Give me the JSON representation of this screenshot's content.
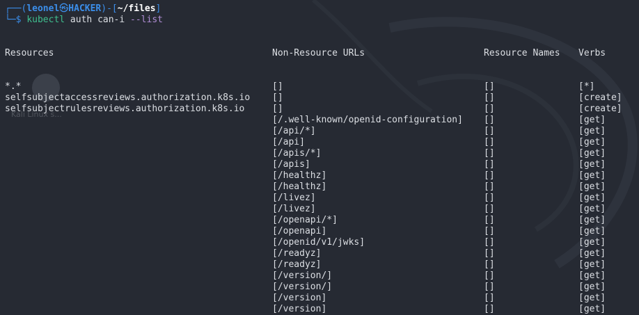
{
  "prompt": {
    "corner_top": "┌──(",
    "user": "leonel",
    "skull": "㉿",
    "host": "HACKER",
    "sep": ")-[",
    "path": "~/files",
    "close": "]",
    "corner_bottom": "└─",
    "dollar": "$",
    "command": "kubectl",
    "args": " auth can-i ",
    "flag": "--list"
  },
  "desktop": {
    "ghost_label": "Kali Linux s..."
  },
  "table": {
    "headers": {
      "resources": "Resources",
      "non_resource_urls": "Non-Resource URLs",
      "resource_names": "Resource Names",
      "verbs": "Verbs"
    },
    "rows": [
      {
        "resources": "*.*",
        "non_resource_urls": "[]",
        "resource_names": "[]",
        "verbs": "[*]"
      },
      {
        "resources": "selfsubjectaccessreviews.authorization.k8s.io",
        "non_resource_urls": "[]",
        "resource_names": "[]",
        "verbs": "[create]"
      },
      {
        "resources": "selfsubjectrulesreviews.authorization.k8s.io",
        "non_resource_urls": "[]",
        "resource_names": "[]",
        "verbs": "[create]"
      },
      {
        "resources": "",
        "non_resource_urls": "[/.well-known/openid-configuration]",
        "resource_names": "[]",
        "verbs": "[get]"
      },
      {
        "resources": "",
        "non_resource_urls": "[/api/*]",
        "resource_names": "[]",
        "verbs": "[get]"
      },
      {
        "resources": "",
        "non_resource_urls": "[/api]",
        "resource_names": "[]",
        "verbs": "[get]"
      },
      {
        "resources": "",
        "non_resource_urls": "[/apis/*]",
        "resource_names": "[]",
        "verbs": "[get]"
      },
      {
        "resources": "",
        "non_resource_urls": "[/apis]",
        "resource_names": "[]",
        "verbs": "[get]"
      },
      {
        "resources": "",
        "non_resource_urls": "[/healthz]",
        "resource_names": "[]",
        "verbs": "[get]"
      },
      {
        "resources": "",
        "non_resource_urls": "[/healthz]",
        "resource_names": "[]",
        "verbs": "[get]"
      },
      {
        "resources": "",
        "non_resource_urls": "[/livez]",
        "resource_names": "[]",
        "verbs": "[get]"
      },
      {
        "resources": "",
        "non_resource_urls": "[/livez]",
        "resource_names": "[]",
        "verbs": "[get]"
      },
      {
        "resources": "",
        "non_resource_urls": "[/openapi/*]",
        "resource_names": "[]",
        "verbs": "[get]"
      },
      {
        "resources": "",
        "non_resource_urls": "[/openapi]",
        "resource_names": "[]",
        "verbs": "[get]"
      },
      {
        "resources": "",
        "non_resource_urls": "[/openid/v1/jwks]",
        "resource_names": "[]",
        "verbs": "[get]"
      },
      {
        "resources": "",
        "non_resource_urls": "[/readyz]",
        "resource_names": "[]",
        "verbs": "[get]"
      },
      {
        "resources": "",
        "non_resource_urls": "[/readyz]",
        "resource_names": "[]",
        "verbs": "[get]"
      },
      {
        "resources": "",
        "non_resource_urls": "[/version/]",
        "resource_names": "[]",
        "verbs": "[get]"
      },
      {
        "resources": "",
        "non_resource_urls": "[/version/]",
        "resource_names": "[]",
        "verbs": "[get]"
      },
      {
        "resources": "",
        "non_resource_urls": "[/version]",
        "resource_names": "[]",
        "verbs": "[get]"
      },
      {
        "resources": "",
        "non_resource_urls": "[/version]",
        "resource_names": "[]",
        "verbs": "[get]"
      }
    ]
  },
  "colors": {
    "background": "#262a33",
    "prompt_blue": "#3b8eea",
    "command_green": "#3fbf8f",
    "flag_purple": "#b18ed6",
    "text": "#dcdfe4"
  }
}
